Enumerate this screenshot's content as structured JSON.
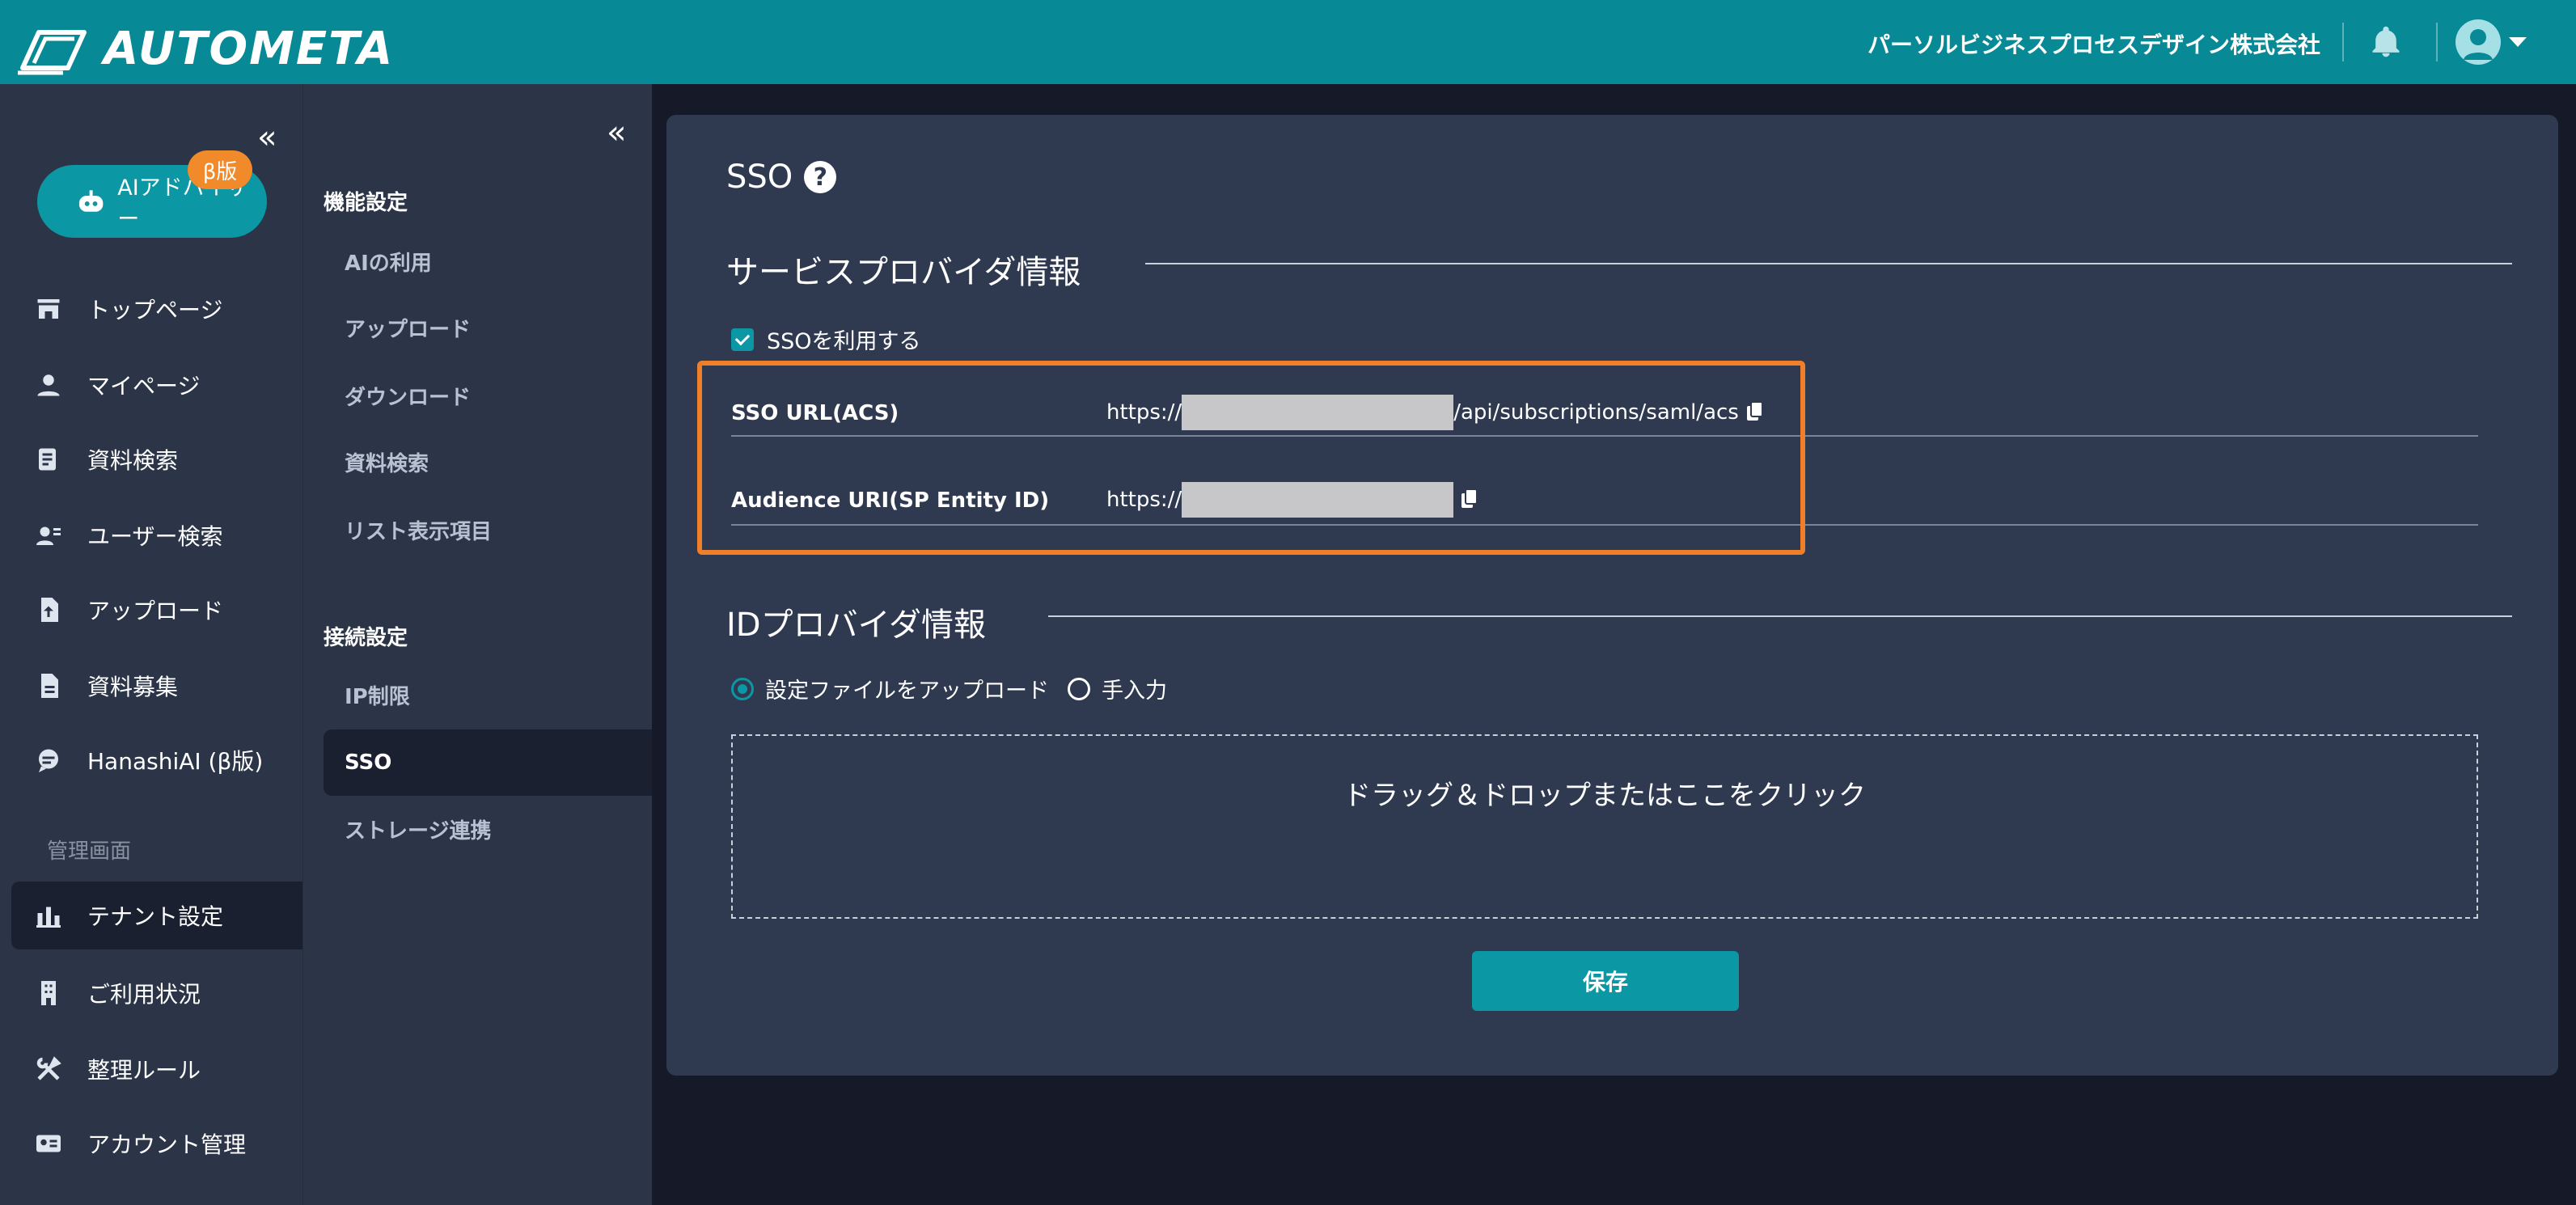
{
  "header": {
    "brand": "AUTOMETA",
    "company": "パーソルビジネスプロセスデザイン株式会社"
  },
  "leftnav": {
    "ai_button": "AIアドバイザー",
    "beta_badge": "β版",
    "items": [
      {
        "label": "トップページ",
        "icon": "store-icon"
      },
      {
        "label": "マイページ",
        "icon": "person-icon"
      },
      {
        "label": "資料検索",
        "icon": "document-search-icon"
      },
      {
        "label": "ユーザー検索",
        "icon": "user-search-icon"
      },
      {
        "label": "アップロード",
        "icon": "upload-icon"
      },
      {
        "label": "資料募集",
        "icon": "file-icon"
      },
      {
        "label": "HanashiAI (β版)",
        "icon": "chat-icon"
      }
    ],
    "section": "管理画面",
    "admin_items": [
      {
        "label": "テナント設定",
        "icon": "chart-icon",
        "active": true
      },
      {
        "label": "ご利用状況",
        "icon": "building-icon"
      },
      {
        "label": "整理ルール",
        "icon": "tools-icon"
      },
      {
        "label": "アカウント管理",
        "icon": "id-card-icon"
      }
    ]
  },
  "subnav": {
    "group1": "機能設定",
    "group1_items": [
      "AIの利用",
      "アップロード",
      "ダウンロード",
      "資料検索",
      "リスト表示項目"
    ],
    "group2": "接続設定",
    "group2_items": [
      "IP制限",
      "SSO",
      "ストレージ連携"
    ],
    "active": "SSO"
  },
  "main": {
    "title": "SSO",
    "sp_section": "サービスプロバイダ情報",
    "use_sso_label": "SSOを利用する",
    "use_sso_checked": true,
    "rows": [
      {
        "label": "SSO URL(ACS)",
        "prefix": "https://",
        "suffix": "/api/subscriptions/saml/acs"
      },
      {
        "label": "Audience URI(SP Entity ID)",
        "prefix": "https://",
        "suffix": ""
      }
    ],
    "idp_section": "IDプロバイダ情報",
    "radio_upload": "設定ファイルをアップロード",
    "radio_manual": "手入力",
    "radio_selected": "設定ファイルをアップロード",
    "dropzone": "ドラッグ＆ドロップまたはここをクリック",
    "save": "保存"
  },
  "colors": {
    "header": "#088996",
    "accent": "#0b97a3",
    "highlight": "#f07f2a",
    "badge": "#f08a2a"
  }
}
